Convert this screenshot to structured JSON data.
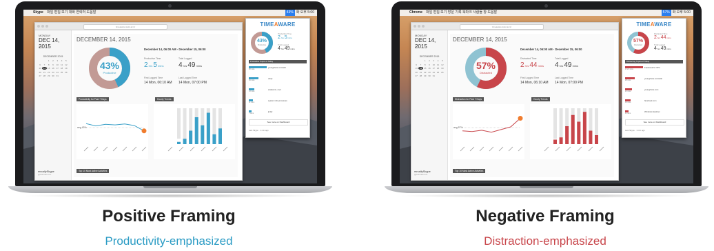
{
  "panels": [
    {
      "id": "positive",
      "menubar": {
        "app": "Skype",
        "items": "파일 편집 보기 대화 연락처 도움말",
        "right": "화 오후 5:00"
      },
      "browser": {
        "url": "timeaware.kaist.ac.kr"
      },
      "sidebar": {
        "day_of_week": "MONDAY",
        "date": "DEC 14, 2015",
        "calendar_header": "DECEMBER 2015",
        "user_name": "mrcallySkype",
        "user_email": "@hotmail.com"
      },
      "main": {
        "title": "DECEMBER 14, 2015",
        "donut_pct": "43%",
        "donut_label": "Productive",
        "range": "December 14, 06:00 AM - December 15, 06:00",
        "primary_label": "Productive Time",
        "primary_h": "2",
        "primary_m": "5",
        "total_label": "Total Logged",
        "total_h": "4",
        "total_m": "49",
        "first_label": "First Logged Time",
        "first_value": "14 Mon, 06:10 AM",
        "last_label": "Last Logged Time",
        "last_value": "14 Mon, 07:00 PM",
        "trend_chip": "Productivity for Past 7 Days",
        "hourly_chip": "Hourly Trends",
        "bottom_chip": "Top 10 Most Active Activities",
        "avg_label": "avg 43%"
      },
      "popup": {
        "logo_a": "TIME",
        "logo_b": "A",
        "logo_c": "WARE",
        "donut_pct": "43%",
        "donut_label": "Productive",
        "primary_label": "Productive Time",
        "primary_h": "2",
        "primary_m": "5",
        "total_label": "Total Logged",
        "total_h": "4",
        "total_m": "49",
        "list_header": "Productive Topics of Today",
        "items": [
          {
            "site": "youngchoie.com/wiki",
            "time": "58 mins"
          },
          {
            "site": "dropl",
            "time": "29 mins"
          },
          {
            "site": "academic, cool",
            "time": "13 mins"
          },
          {
            "site": "system info processes",
            "time": "11 mins"
          },
          {
            "site": "jimlly",
            "time": "7 mins"
          }
        ],
        "button": "See more on Dashboard",
        "footer": "Last Skype · 1 min ago"
      },
      "caption": {
        "title": "Positive Framing",
        "subtitle": "Productivity-emphasized"
      }
    },
    {
      "id": "negative",
      "menubar": {
        "app": "Chrome",
        "items": "파일 편집 보기 방문 기록 북마크 사람들 창 도움말",
        "right": "화 오후 5:00"
      },
      "browser": {
        "url": "timeaware.kaist.ac.kr"
      },
      "sidebar": {
        "day_of_week": "MONDAY",
        "date": "DEC 14, 2015",
        "calendar_header": "DECEMBER 2015",
        "user_name": "mrcallySkype",
        "user_email": "@hotmail.com"
      },
      "main": {
        "title": "DECEMBER 14, 2015",
        "donut_pct": "57%",
        "donut_label": "Distracted",
        "range": "December 14, 06:00 AM - December 15, 06:00",
        "primary_label": "Distracted Time",
        "primary_h": "2",
        "primary_m": "44",
        "total_label": "Total Logged",
        "total_h": "4",
        "total_m": "49",
        "first_label": "First Logged Time",
        "first_value": "14 Mon, 06:10 AM",
        "last_label": "Last Logged Time",
        "last_value": "14 Mon, 07:00 PM",
        "trend_chip": "Distraction for Past 7 Days",
        "hourly_chip": "Hourly Trends",
        "bottom_chip": "Top 10 Most Active Activities",
        "avg_label": "avg 57%"
      },
      "popup": {
        "logo_a": "TIME",
        "logo_b": "A",
        "logo_c": "WARE",
        "donut_pct": "57%",
        "donut_label": "Distracted",
        "primary_label": "Distracted Time",
        "primary_h": "2",
        "primary_m": "44",
        "total_label": "Total Logged",
        "total_h": "4",
        "total_m": "49",
        "list_header": "Distracting Topics of Today",
        "items": [
          {
            "site": "Facebook for XP's",
            "time": "1 hr 9 mins"
          },
          {
            "site": "youngchoie.com/wiki",
            "time": "28 mins"
          },
          {
            "site": "youngchoie.com",
            "time": "21 mins"
          },
          {
            "site": "facebook.com",
            "time": "16 mins"
          },
          {
            "site": "Windows Explorer",
            "time": "11 mins"
          }
        ],
        "button": "See more on Dashboard",
        "footer": "Last Skype · 1 min ago"
      },
      "caption": {
        "title": "Negative Framing",
        "subtitle": "Distraction-emphasized"
      }
    }
  ],
  "colors": {
    "productive": "#3aa0c8",
    "productive_muted": "#c29a95",
    "distracted": "#c8454a",
    "distracted_muted": "#8fc3d2",
    "orange": "#f07c2e",
    "caption_pos": "#2a9bc4",
    "caption_neg": "#c8454a"
  },
  "trend_values": {
    "positive": [
      62,
      55,
      60,
      58,
      61,
      56,
      40
    ],
    "negative": [
      40,
      38,
      42,
      36,
      44,
      52,
      78
    ]
  },
  "hourly_values": {
    "positive": [
      5,
      12,
      30,
      60,
      42,
      70,
      22,
      35
    ],
    "negative": [
      10,
      15,
      40,
      65,
      50,
      72,
      30,
      20
    ]
  }
}
